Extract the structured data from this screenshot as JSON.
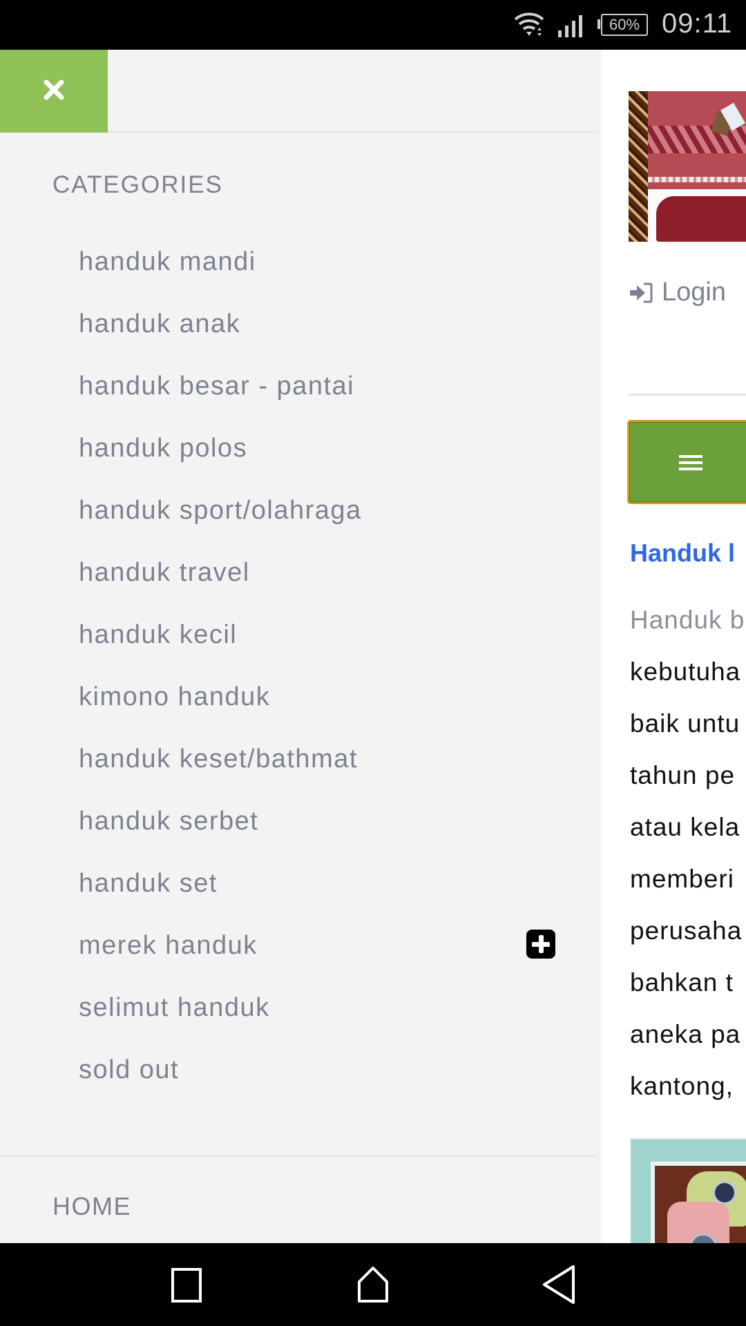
{
  "status_bar": {
    "battery": "60%",
    "time": "09:11",
    "icons": [
      "wifi-icon",
      "cellular-signal-icon",
      "battery-icon"
    ]
  },
  "drawer": {
    "close_icon": "close-icon",
    "categories_title": "CATEGORIES",
    "categories": [
      {
        "label": "handuk mandi"
      },
      {
        "label": "handuk anak"
      },
      {
        "label": "handuk besar - pantai"
      },
      {
        "label": "handuk polos"
      },
      {
        "label": "handuk sport/olahraga"
      },
      {
        "label": "handuk travel"
      },
      {
        "label": "handuk kecil"
      },
      {
        "label": "kimono handuk"
      },
      {
        "label": "handuk keset/bathmat"
      },
      {
        "label": "handuk serbet"
      },
      {
        "label": "handuk set"
      },
      {
        "label": "merek handuk",
        "expandable": true
      },
      {
        "label": "selimut handuk"
      },
      {
        "label": "sold out"
      }
    ],
    "home_label": "HOME"
  },
  "page": {
    "login_label": "Login",
    "heading": "Handuk l",
    "article_lines": [
      "Handuk b",
      "kebutuha",
      "baik untu",
      "tahun pe",
      "atau kela",
      "memberi",
      "perusaha",
      "bahkan t",
      "aneka pa",
      "kantong,"
    ]
  },
  "colors": {
    "drawer_bg": "#f3f3f3",
    "close_button": "#8fc156",
    "menu_button": "#6ba03a",
    "menu_button_border": "#d99a16",
    "heading_link": "#2f66e8",
    "muted_text": "#7d8291"
  },
  "nav_bar": {
    "buttons": [
      "recent-apps",
      "home",
      "back"
    ]
  }
}
